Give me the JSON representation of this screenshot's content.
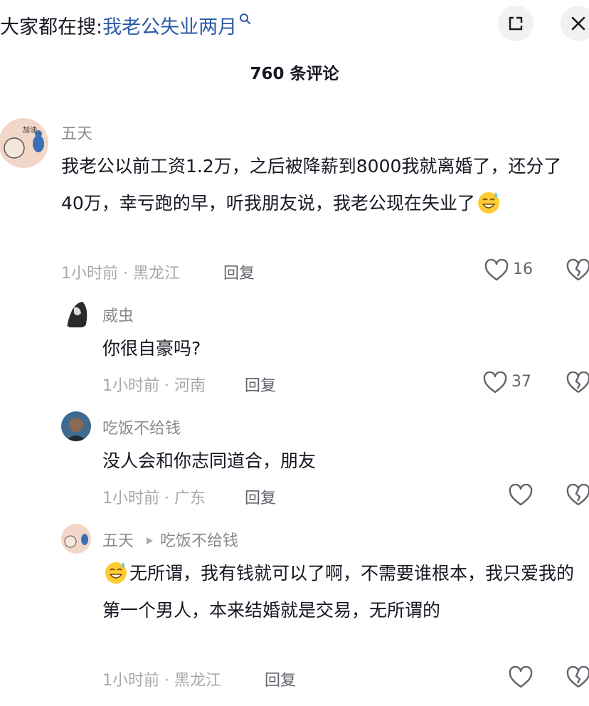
{
  "search": {
    "prefix": "大家都在搜:",
    "query": "我老公失业两月"
  },
  "header": {
    "comment_count": "760 条评论"
  },
  "comments": [
    {
      "user": "五天",
      "text": "我老公以前工资1.2万，之后被降薪到8000我就离婚了，还分了40万，幸亏跑的早，听我朋友说，我老公现在失业了",
      "time": "1小时前",
      "region": "黑龙江",
      "reply_label": "回复",
      "likes": "16",
      "avatar_text": "加油"
    },
    {
      "user": "威虫",
      "text": "你很自豪吗?",
      "time": "1小时前",
      "region": "河南",
      "reply_label": "回复",
      "likes": "37"
    },
    {
      "user": "吃饭不给钱",
      "text": "没人会和你志同道合，朋友",
      "time": "1小时前",
      "region": "广东",
      "reply_label": "回复",
      "likes": ""
    },
    {
      "user": "五天",
      "reply_to": "吃饭不给钱",
      "text": "无所谓，我有钱就可以了啊，不需要谁根本，我只爱我的第一个男人，本来结婚就是交易，无所谓的",
      "time": "1小时前",
      "region": "黑龙江",
      "reply_label": "回复",
      "likes": ""
    }
  ],
  "icons": {
    "search": "magnifier-icon",
    "expand": "expand-icon",
    "close": "close-icon",
    "like": "heart-outline-icon",
    "dislike": "broken-heart-icon",
    "emoji": "sweat-smile-emoji-icon",
    "reply_arrow": "play-triangle-icon"
  },
  "colors": {
    "accent": "#2b5ba8",
    "meta": "#a7a8ad",
    "username": "#8a8b91"
  }
}
